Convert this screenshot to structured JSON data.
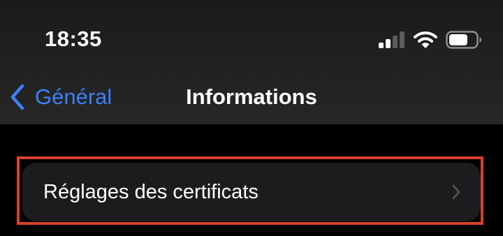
{
  "status_bar": {
    "time": "18:35",
    "icons": [
      "cellular-signal-icon",
      "wifi-icon",
      "battery-icon"
    ]
  },
  "nav_bar": {
    "back_label": "Général",
    "title": "Informations"
  },
  "list": {
    "items": [
      {
        "label": "Réglages des certificats",
        "highlighted": true
      }
    ]
  },
  "colors": {
    "accent": "#3a82f7",
    "highlight_frame": "#d9402b",
    "row_background": "#1c1c1e",
    "background": "#000000",
    "chevron": "#5a5a5e"
  }
}
